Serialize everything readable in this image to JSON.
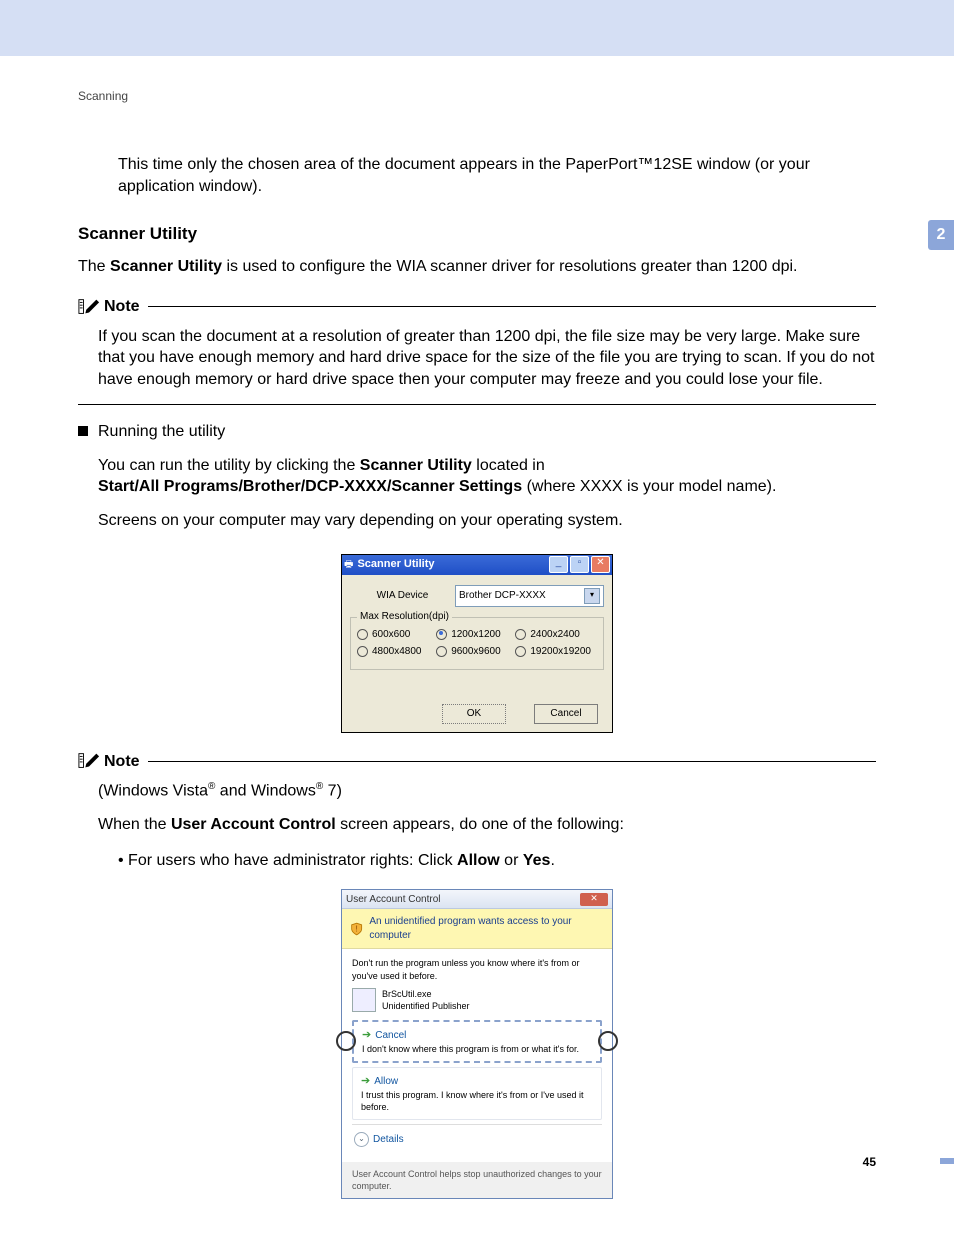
{
  "header": {
    "section": "Scanning"
  },
  "sidebar": {
    "chapter": "2"
  },
  "body": {
    "intro": "This time only the chosen area of the document appears in the PaperPort™12SE window (or your application window).",
    "h_scanner_utility": "Scanner Utility",
    "desc_pre": "The ",
    "desc_bold": "Scanner Utility",
    "desc_post": " is used to configure the WIA scanner driver for resolutions greater than 1200 dpi.",
    "running_title": "Running the utility",
    "run_line1_a": "You can run the utility by clicking the ",
    "run_line1_b": "Scanner Utility",
    "run_line1_c": " located in",
    "run_path": "Start/All Programs/Brother/DCP-XXXX/Scanner Settings",
    "run_path_tail": " (where XXXX is your model name).",
    "run_line2": "Screens on your computer may vary depending on your operating system."
  },
  "note1": {
    "title": "Note",
    "body": "If you scan the document at a resolution of greater than 1200 dpi, the file size may be very large. Make sure that you have enough memory and hard drive space for the size of the file you are trying to scan. If you do not have enough memory or hard drive space then your computer may freeze and you could lose your file."
  },
  "dialog1": {
    "title": "Scanner Utility",
    "wia_label": "WIA Device",
    "wia_value": "Brother DCP-XXXX",
    "group_title": "Max Resolution(dpi)",
    "options": [
      "600x600",
      "1200x1200",
      "2400x2400",
      "4800x4800",
      "9600x9600",
      "19200x19200"
    ],
    "selected_index": 1,
    "ok": "OK",
    "cancel": "Cancel"
  },
  "note2": {
    "title": "Note",
    "line1a": "(Windows Vista",
    "line1b": " and Windows",
    "line1c": " 7)",
    "reg": "®",
    "line2a": "When the ",
    "line2b": "User Account Control",
    "line2c": " screen appears, do one of the following:",
    "bullet_a": "For users who have administrator rights: Click ",
    "bullet_b": "Allow",
    "bullet_c": " or ",
    "bullet_d": "Yes"
  },
  "dialog2": {
    "title": "User Account Control",
    "banner": "An unidentified program wants access to your computer",
    "warn": "Don't run the program unless you know where it's from or you've used it before.",
    "app_name": "BrScUtil.exe",
    "app_pub": "Unidentified Publisher",
    "cancel_h": "Cancel",
    "cancel_b": "I don't know where this program is from or what it's for.",
    "allow_h": "Allow",
    "allow_b": "I trust this program. I know where it's from or I've used it before.",
    "details": "Details",
    "footer": "User Account Control helps stop unauthorized changes to your computer."
  },
  "footer": {
    "page": "45"
  }
}
